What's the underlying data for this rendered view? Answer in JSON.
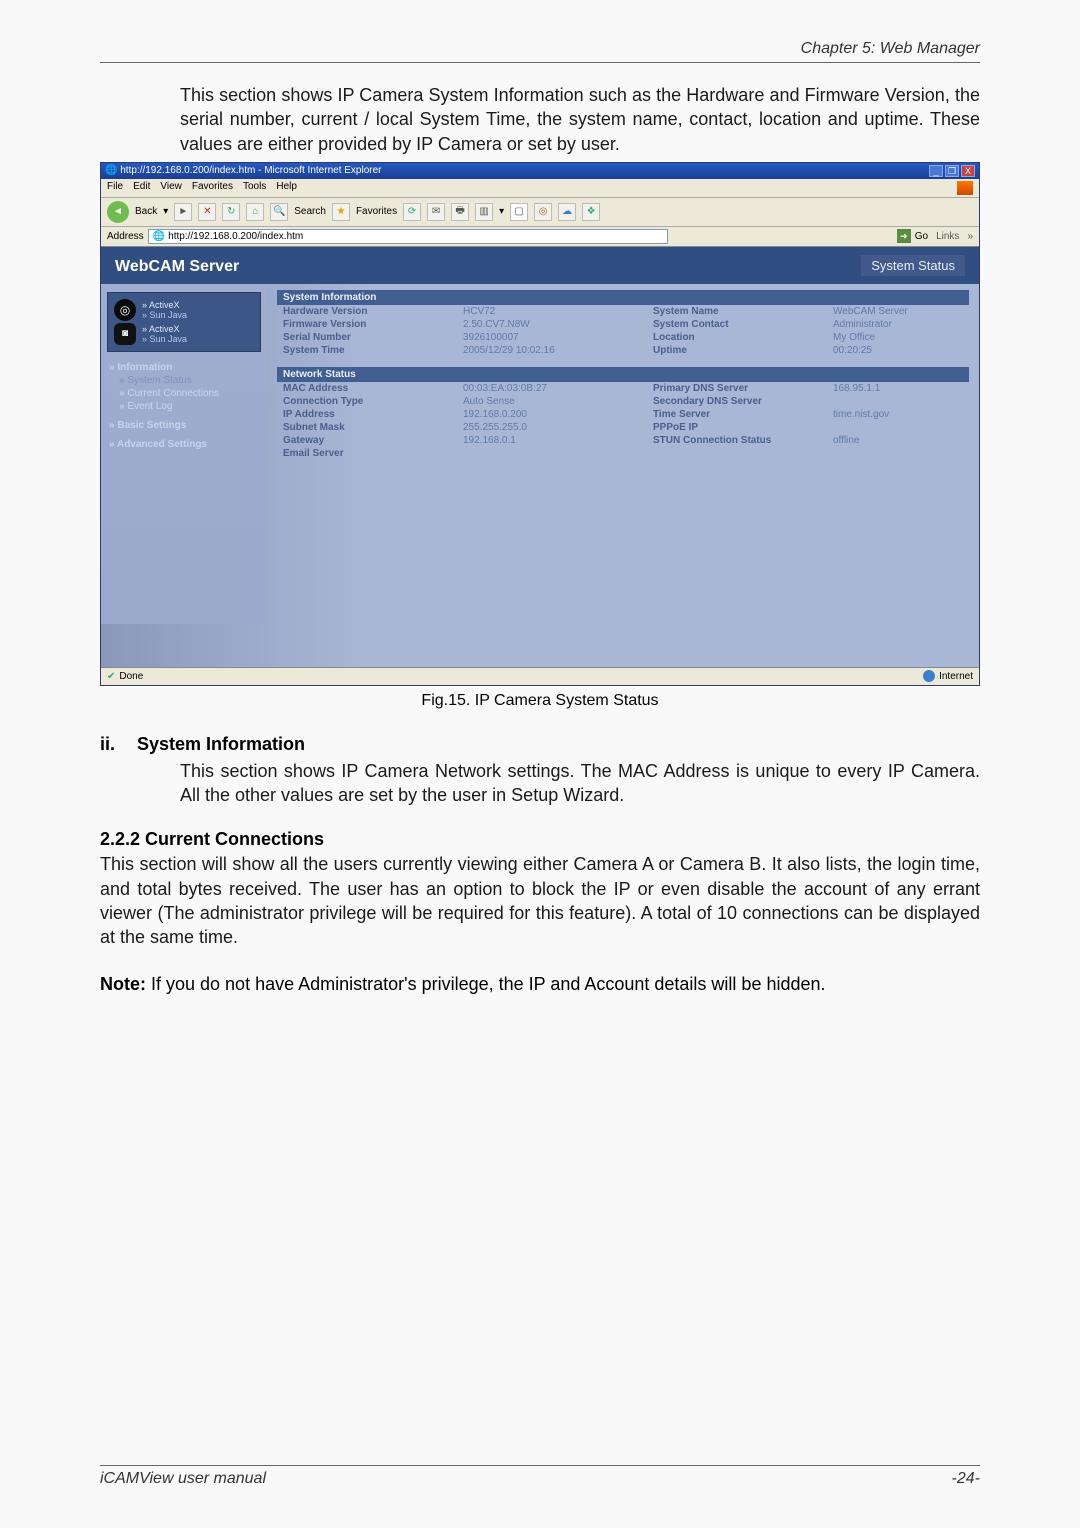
{
  "chapter": "Chapter 5: Web Manager",
  "intro": "This section shows IP Camera System Information such as the Hardware and Firmware Version, the serial number, current / local System Time, the system name, contact, location and uptime. These values are either provided by IP Camera or set by user.",
  "browser": {
    "title": "http://192.168.0.200/index.htm - Microsoft Internet Explorer",
    "minimize": "_",
    "maximize": "❐",
    "close": "X",
    "menu": {
      "file": "File",
      "edit": "Edit",
      "view": "View",
      "favorites": "Favorites",
      "tools": "Tools",
      "help": "Help"
    },
    "toolbar": {
      "back_label": "Back",
      "search": "Search",
      "favorites": "Favorites"
    },
    "address_label": "Address",
    "address_value": "http://192.168.0.200/index.htm",
    "go": "Go",
    "links": "Links",
    "webcam_title": "WebCAM Server",
    "system_status": "System Status",
    "camera": {
      "activex": "ActiveX",
      "sunjava": "Sun Java"
    },
    "nav": {
      "information": "Information",
      "system_status": "System Status",
      "current_connections": "Current Connections",
      "event_log": "Event Log",
      "basic_settings": "Basic Settings",
      "advanced_settings": "Advanced Settings"
    },
    "sysinfo": {
      "head": "System Information",
      "hw_label": "Hardware Version",
      "hw_val": "HCV72",
      "fw_label": "Firmware Version",
      "fw_val": "2.50.CV7.N8W",
      "sn_label": "Serial Number",
      "sn_val": "3926100007",
      "st_label": "System Time",
      "st_val": "2005/12/29 10:02:16",
      "name_label": "System Name",
      "name_val": "WebCAM Server",
      "contact_label": "System Contact",
      "contact_val": "Administrator",
      "loc_label": "Location",
      "loc_val": "My Office",
      "uptime_label": "Uptime",
      "uptime_val": "00:20:25"
    },
    "netstat": {
      "head": "Network Status",
      "mac_label": "MAC Address",
      "mac_val": "00:03:EA:03:0B:27",
      "ct_label": "Connection Type",
      "ct_val": "Auto Sense",
      "ip_label": "IP Address",
      "ip_val": "192.168.0.200",
      "sm_label": "Subnet Mask",
      "sm_val": "255.255.255.0",
      "gw_label": "Gateway",
      "gw_val": "192.168.0.1",
      "es_label": "Email Server",
      "es_val": "",
      "pdns_label": "Primary DNS Server",
      "pdns_val": "168.95.1.1",
      "sdns_label": "Secondary DNS Server",
      "sdns_val": "",
      "ts_label": "Time Server",
      "ts_val": "time.nist.gov",
      "pppoe_label": "PPPoE IP",
      "pppoe_val": "",
      "stun_label": "STUN Connection Status",
      "stun_val": "offline"
    },
    "status_done": "Done",
    "status_internet": "Internet"
  },
  "fig_caption": "Fig.15.  IP Camera System Status",
  "sec2": {
    "num": "ii.",
    "title": "System Information",
    "body": "This section shows IP Camera Network settings.   The MAC Address is unique to every IP Camera.   All the other values are set by the user in Setup Wizard."
  },
  "sec3": {
    "title": "2.2.2 Current Connections",
    "body": "This section will show all the users currently viewing either Camera A or Camera B. It also lists, the login time, and total bytes received.   The user has an option to block the IP or even disable the account of any errant viewer (The administrator privilege will be required for this feature).   A total of 10 connections can be displayed at the same time."
  },
  "note_label": "Note:",
  "note_body": " If you do not have Administrator's privilege, the IP and Account details will be hidden.",
  "footer_left": "iCAMView  user  manual",
  "footer_right": "-24-"
}
